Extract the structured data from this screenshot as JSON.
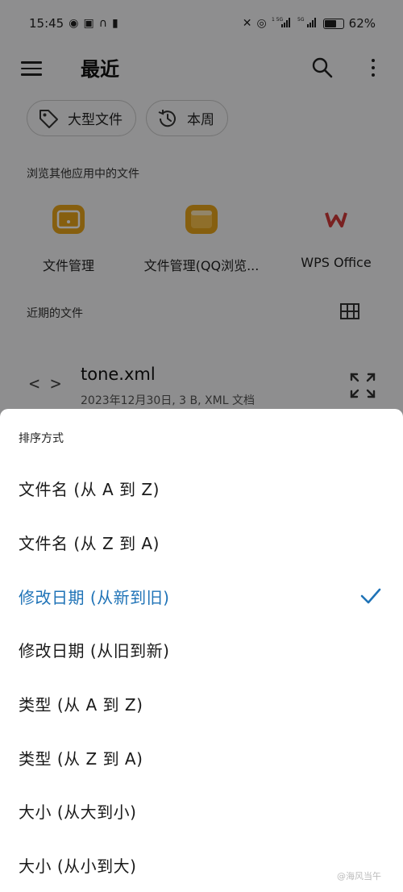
{
  "status_bar": {
    "time": "15:45",
    "battery": "62%",
    "net_1": "1 5G",
    "net_2": "5G"
  },
  "app_bar": {
    "title": "最近",
    "menu_icon": "hamburger-menu-icon",
    "search_icon": "search-icon",
    "more_icon": "more-vert-icon"
  },
  "chips": [
    {
      "label": "大型文件",
      "icon": "tag-icon"
    },
    {
      "label": "本周",
      "icon": "history-icon"
    }
  ],
  "browse_section": {
    "title": "浏览其他应用中的文件",
    "apps": [
      {
        "label": "文件管理",
        "icon": "file-manager-icon",
        "color": "#e7a41b"
      },
      {
        "label": "文件管理(QQ浏览...",
        "icon": "qq-file-manager-icon",
        "color": "#e7a41b"
      },
      {
        "label": "WPS Office",
        "icon": "wps-office-icon",
        "color": "#d13a3a"
      }
    ]
  },
  "recent_section": {
    "title": "近期的文件",
    "grid_icon": "grid-view-icon",
    "files": [
      {
        "name": "tone.xml",
        "meta": "2023年12月30日, 3 B, XML 文档",
        "icon": "code-icon"
      }
    ]
  },
  "sort_sheet": {
    "title": "排序方式",
    "accent": "#1f73b7",
    "options": [
      {
        "label": "文件名 (从 A 到 Z)",
        "selected": false
      },
      {
        "label": "文件名 (从 Z 到 A)",
        "selected": false
      },
      {
        "label": "修改日期 (从新到旧)",
        "selected": true
      },
      {
        "label": "修改日期 (从旧到新)",
        "selected": false
      },
      {
        "label": "类型 (从 A 到 Z)",
        "selected": false
      },
      {
        "label": "类型 (从 Z 到 A)",
        "selected": false
      },
      {
        "label": "大小 (从大到小)",
        "selected": false
      },
      {
        "label": "大小 (从小到大)",
        "selected": false
      }
    ]
  },
  "watermark": "@海风当午"
}
